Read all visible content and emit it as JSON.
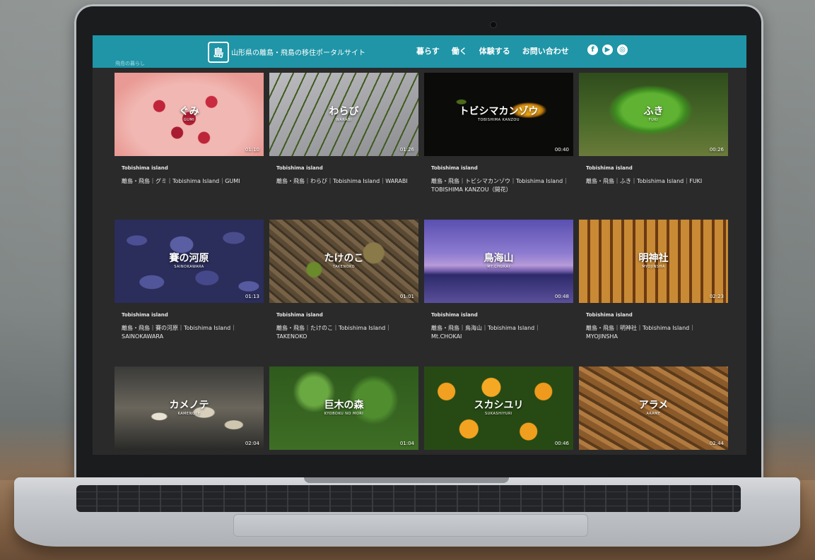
{
  "header": {
    "logo_text": "島",
    "site_title": "山形県の離島・飛島の移住ポータルサイト",
    "nav": [
      "暮らす",
      "働く",
      "体験する",
      "お問い合わせ"
    ],
    "social": [
      {
        "icon": "facebook-icon",
        "glyph": "f"
      },
      {
        "icon": "youtube-icon",
        "glyph": "▶"
      },
      {
        "icon": "instagram-icon",
        "glyph": "◎"
      }
    ],
    "breadcrumb": "飛島の暮らし"
  },
  "cards": [
    {
      "title": "ぐみ",
      "subtitle": "GUMI",
      "duration": "01:10",
      "channel": "Tobishima island",
      "caption": "離島・飛島｜グミ｜Tobishima Island｜GUMI"
    },
    {
      "title": "わらび",
      "subtitle": "WARABI",
      "duration": "01:26",
      "channel": "Tobishima island",
      "caption": "離島・飛島｜わらび｜Tobishima Island｜WARABI"
    },
    {
      "title": "トビシマカンゾウ",
      "subtitle": "TOBISHIMA KANZOU",
      "duration": "00:40",
      "channel": "Tobishima island",
      "caption": "離島・飛島｜トビシマカンゾウ｜Tobishima Island｜TOBISHIMA KANZOU（開花）"
    },
    {
      "title": "ふき",
      "subtitle": "FUKI",
      "duration": "00:26",
      "channel": "Tobishima island",
      "caption": "離島・飛島｜ふき｜Tobishima Island｜FUKI"
    },
    {
      "title": "賽の河原",
      "subtitle": "SAINOKAWARA",
      "duration": "01:13",
      "channel": "Tobishima island",
      "caption": "離島・飛島｜賽の河原｜Tobishima Island｜SAINOKAWARA"
    },
    {
      "title": "たけのこ",
      "subtitle": "TAKENOKO",
      "duration": "01:01",
      "channel": "Tobishima island",
      "caption": "離島・飛島｜たけのこ｜Tobishima Island｜TAKENOKO"
    },
    {
      "title": "鳥海山",
      "subtitle": "MT.CHOKAI",
      "duration": "00:48",
      "channel": "Tobishima island",
      "caption": "離島・飛島｜鳥海山｜Tobishima Island｜Mt.CHOKAI"
    },
    {
      "title": "明神社",
      "subtitle": "MYOJINSHA",
      "duration": "02:23",
      "channel": "Tobishima island",
      "caption": "離島・飛島｜明神社｜Tobishima Island｜MYOJINSHA"
    },
    {
      "title": "カメノテ",
      "subtitle": "KAMENOTE",
      "duration": "02:04",
      "channel": "",
      "caption": ""
    },
    {
      "title": "巨木の森",
      "subtitle": "KYOBOKU NO MORI",
      "duration": "01:04",
      "channel": "",
      "caption": ""
    },
    {
      "title": "スカシユリ",
      "subtitle": "SUKASHIYURI",
      "duration": "00:46",
      "channel": "",
      "caption": ""
    },
    {
      "title": "アラメ",
      "subtitle": "ARAME",
      "duration": "02:44",
      "channel": "",
      "caption": ""
    }
  ]
}
